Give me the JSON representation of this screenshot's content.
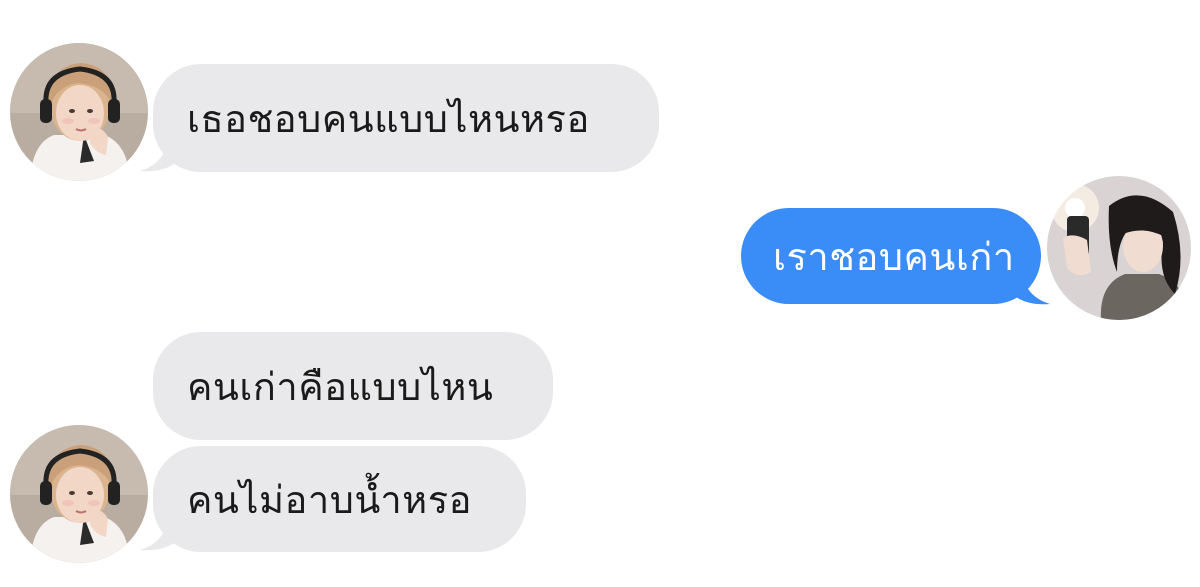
{
  "conversation": {
    "participants": {
      "friend": {
        "avatar_icon": "girl-with-headphones-avatar-icon"
      },
      "me": {
        "avatar_icon": "girl-mirror-selfie-avatar-icon"
      }
    },
    "messages": [
      {
        "sender": "friend",
        "text": "เธอชอบคนแบบไหนหรอ"
      },
      {
        "sender": "me",
        "text": "เราชอบคนเก่า"
      },
      {
        "sender": "friend",
        "text": "คนเก่าคือแบบไหน"
      },
      {
        "sender": "friend",
        "text": "คนไม่อาบน้ำหรอ"
      }
    ]
  },
  "colors": {
    "incoming_bubble": "#e9e9eb",
    "outgoing_bubble": "#3a8cf6",
    "incoming_text": "#1a1a1a",
    "outgoing_text": "#ffffff",
    "background": "#ffffff"
  }
}
